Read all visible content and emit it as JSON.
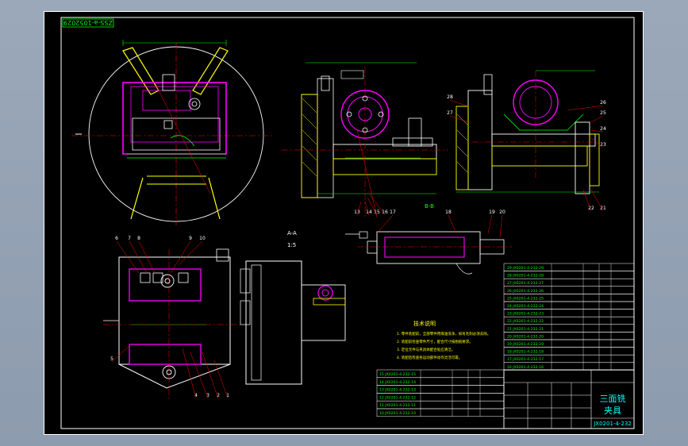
{
  "drawing": {
    "stamp_code": "ZSS-a-1052029",
    "title": "三面铣",
    "title_line2": "夹具",
    "drawing_no": "JX0201-4-232",
    "notes_title": "技术说明",
    "notes": [
      "1. 零件装配前，全部零件用煤油洗净，如有毛刺必须去除。",
      "2. 装配前检查零件尺寸，配合尺寸按图纸要求。",
      "3. 定位元件与夹具体配合处应清洁。",
      "4. 装配后检查各运动部件动作灵活可靠。"
    ],
    "section_label": "A-A",
    "section_label_b": "B-B",
    "scale_label": "1:5",
    "colors": {
      "outline": "#ffffff",
      "green": "#00ff00",
      "yellow": "#ffff00",
      "magenta": "#ff00ff",
      "red": "#ff0000",
      "cyan": "#00ffff"
    }
  },
  "balloons_top": [
    "1",
    "2",
    "3",
    "4",
    "5",
    "6",
    "7",
    "8",
    "9",
    "10"
  ],
  "balloons_mid": [
    "13",
    "14",
    "15",
    "16",
    "17",
    "18",
    "19",
    "20"
  ],
  "balloons_side": [
    "21",
    "22",
    "23",
    "24",
    "25",
    "26",
    "27",
    "28"
  ],
  "bom_rows": [
    "29 JX0201-4-232-29",
    "28 JX0201-4-232-28",
    "27 JX0201-4-232-27",
    "26 JX0201-4-232-26",
    "25 JX0201-4-232-25",
    "24 JX0201-4-232-24",
    "23 JX0201-4-232-23",
    "22 JX0201-4-232-22",
    "21 JX0201-4-232-21",
    "20 JX0201-4-232-20",
    "19 JX0201-4-232-19",
    "18 JX0201-4-232-18",
    "17 JX0201-4-232-17",
    "16 JX0201-4-232-16"
  ],
  "bom_lower": [
    "15 JX0201-4-232-15",
    "14 JX0201-4-232-14",
    "13 JX0201-4-232-13",
    "12 JX0201-4-232-12",
    "11 JX0201-4-232-11",
    "10 JX0201-4-232-10"
  ]
}
